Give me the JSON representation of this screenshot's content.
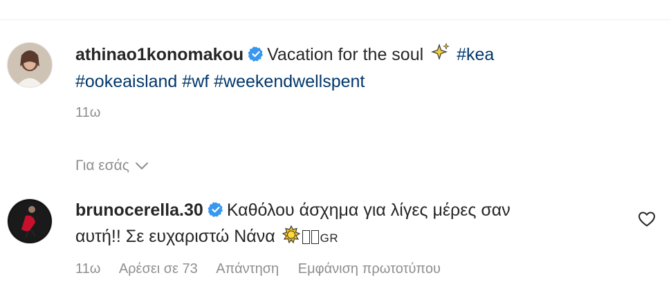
{
  "caption": {
    "username": "athinao1konomakou",
    "text_prefix": "Vacation for the soul ",
    "hashtags_line1": "#kea",
    "hashtags_line2": [
      "#ookeaisland",
      "#wf",
      "#weekendwellspent"
    ],
    "time": "11ω"
  },
  "for_you": {
    "label": "Για εσάς"
  },
  "comment": {
    "username": "brunocerella.30",
    "text_line1": "Καθόλου άσχημα για λίγες μέρες σαν",
    "text_line2": "αυτή!! Σε ευχαριστώ Νάνα ",
    "flag_suffix": "GR",
    "time": "11ω",
    "likes": "Αρέσει σε 73",
    "reply": "Απάντηση",
    "see_translation": "Εμφάνιση πρωτοτύπου"
  },
  "colors": {
    "hashtag": "#00376b",
    "verified": "#3897f0",
    "muted": "#8e8e8e",
    "text": "#262626"
  },
  "icons": [
    "verified-badge-icon",
    "sparkles-emoji-icon",
    "sun-emoji-icon",
    "chevron-down-icon",
    "heart-icon"
  ]
}
